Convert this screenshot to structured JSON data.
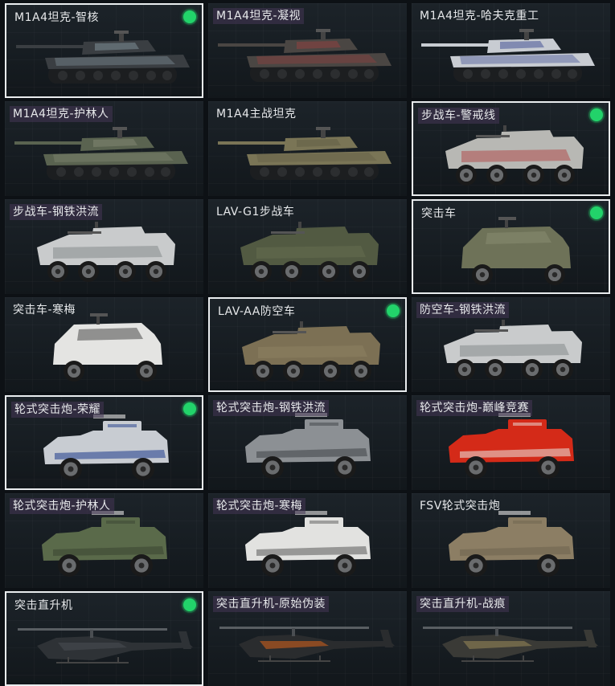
{
  "vehicles": [
    {
      "name": "M1A4坦克-智核",
      "type": "tank",
      "selected": true,
      "equipped": true,
      "tinted": false,
      "body": "#3a3e42",
      "accent": "#8fa0a8"
    },
    {
      "name": "M1A4坦克-凝视",
      "type": "tank",
      "selected": false,
      "equipped": false,
      "tinted": true,
      "body": "#4a4643",
      "accent": "#a04040"
    },
    {
      "name": "M1A4坦克-哈夫克重工",
      "type": "tank",
      "selected": false,
      "equipped": false,
      "tinted": false,
      "body": "#c8ccd2",
      "accent": "#2a3a8a"
    },
    {
      "name": "M1A4坦克-护林人",
      "type": "tank",
      "selected": false,
      "equipped": false,
      "tinted": true,
      "body": "#5a6350",
      "accent": "#8a8f78"
    },
    {
      "name": "M1A4主战坦克",
      "type": "tank",
      "selected": false,
      "equipped": false,
      "tinted": false,
      "body": "#7a7556",
      "accent": "#5e5a42"
    },
    {
      "name": "步战车-警戒线",
      "type": "ifv",
      "selected": true,
      "equipped": true,
      "tinted": true,
      "body": "#b8b8b4",
      "accent": "#b02828"
    },
    {
      "name": "步战车-钢铁洪流",
      "type": "ifv",
      "selected": false,
      "equipped": false,
      "tinted": true,
      "body": "#c9cbcc",
      "accent": "#6e7276"
    },
    {
      "name": "LAV-G1步战车",
      "type": "ifv",
      "selected": false,
      "equipped": false,
      "tinted": false,
      "body": "#525a42",
      "accent": "#6b7356"
    },
    {
      "name": "突击车",
      "type": "suv",
      "selected": true,
      "equipped": true,
      "tinted": false,
      "body": "#6e7258",
      "accent": "#8a8e72"
    },
    {
      "name": "突击车-寒梅",
      "type": "suv",
      "selected": false,
      "equipped": false,
      "tinted": false,
      "body": "#e4e4e2",
      "accent": "#3c3c3c"
    },
    {
      "name": "LAV-AA防空车",
      "type": "ifv",
      "selected": true,
      "equipped": true,
      "tinted": false,
      "body": "#7c7054",
      "accent": "#948866"
    },
    {
      "name": "防空车-钢铁洪流",
      "type": "ifv",
      "selected": false,
      "equipped": false,
      "tinted": true,
      "body": "#c9cbcc",
      "accent": "#6e7276"
    },
    {
      "name": "轮式突击炮-荣耀",
      "type": "apc",
      "selected": true,
      "equipped": true,
      "tinted": true,
      "body": "#c8ccd2",
      "accent": "#1e3a8a"
    },
    {
      "name": "轮式突击炮-钢铁洪流",
      "type": "apc",
      "selected": false,
      "equipped": false,
      "tinted": true,
      "body": "#8c9094",
      "accent": "#3e4246"
    },
    {
      "name": "轮式突击炮-巅峰竞赛",
      "type": "apc",
      "selected": false,
      "equipped": false,
      "tinted": true,
      "body": "#d42a18",
      "accent": "#e8e6e2"
    },
    {
      "name": "轮式突击炮-护林人",
      "type": "apc",
      "selected": false,
      "equipped": false,
      "tinted": true,
      "body": "#5a6a4a",
      "accent": "#3a4432"
    },
    {
      "name": "轮式突击炮-寒梅",
      "type": "apc",
      "selected": false,
      "equipped": false,
      "tinted": true,
      "body": "#e2e2e0",
      "accent": "#5a5a5a"
    },
    {
      "name": "FSV轮式突击炮",
      "type": "apc",
      "selected": false,
      "equipped": false,
      "tinted": false,
      "body": "#8c7e64",
      "accent": "#6e634e"
    },
    {
      "name": "突击直升机",
      "type": "heli",
      "selected": true,
      "equipped": true,
      "tinted": false,
      "body": "#2e3236",
      "accent": "#4a4f54"
    },
    {
      "name": "突击直升机-原始伪装",
      "type": "heli",
      "selected": false,
      "equipped": false,
      "tinted": true,
      "body": "#2a2c2e",
      "accent": "#d8641c"
    },
    {
      "name": "突击直升机-战痕",
      "type": "heli",
      "selected": false,
      "equipped": false,
      "tinted": true,
      "body": "#3a3a36",
      "accent": "#9a8a5a"
    }
  ]
}
